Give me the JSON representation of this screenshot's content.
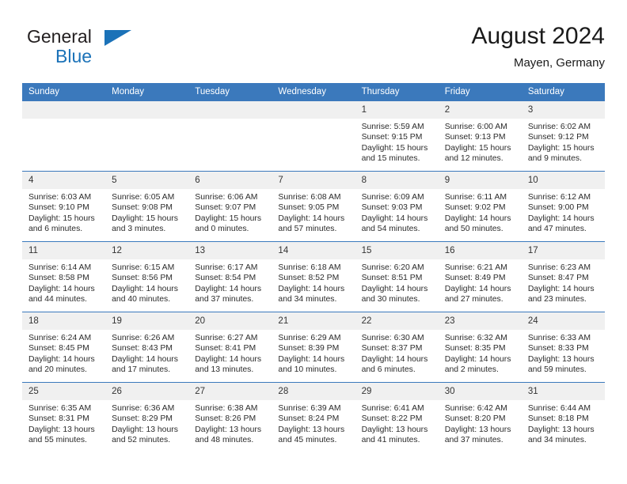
{
  "brand": {
    "name_part1": "General",
    "name_part2": "Blue",
    "accent_color": "#1b72b8",
    "logo_icon": "triangle-mark"
  },
  "header": {
    "title": "August 2024",
    "subtitle": "Mayen, Germany"
  },
  "theme": {
    "header_blue": "#3b79bc",
    "daynum_band": "#f0f0f0",
    "text": "#2b2b2b"
  },
  "weekdays": [
    "Sunday",
    "Monday",
    "Tuesday",
    "Wednesday",
    "Thursday",
    "Friday",
    "Saturday"
  ],
  "labels": {
    "sunrise_prefix": "Sunrise:",
    "sunset_prefix": "Sunset:",
    "daylight_prefix": "Daylight:"
  },
  "weeks": [
    [
      {
        "day": "",
        "blank": true,
        "l1": "",
        "l2": "",
        "l3": "",
        "l4": ""
      },
      {
        "day": "",
        "blank": true,
        "l1": "",
        "l2": "",
        "l3": "",
        "l4": ""
      },
      {
        "day": "",
        "blank": true,
        "l1": "",
        "l2": "",
        "l3": "",
        "l4": ""
      },
      {
        "day": "",
        "blank": true,
        "l1": "",
        "l2": "",
        "l3": "",
        "l4": ""
      },
      {
        "day": "1",
        "blank": false,
        "l1": "Sunrise: 5:59 AM",
        "l2": "Sunset: 9:15 PM",
        "l3": "Daylight: 15 hours",
        "l4": "and 15 minutes."
      },
      {
        "day": "2",
        "blank": false,
        "l1": "Sunrise: 6:00 AM",
        "l2": "Sunset: 9:13 PM",
        "l3": "Daylight: 15 hours",
        "l4": "and 12 minutes."
      },
      {
        "day": "3",
        "blank": false,
        "l1": "Sunrise: 6:02 AM",
        "l2": "Sunset: 9:12 PM",
        "l3": "Daylight: 15 hours",
        "l4": "and 9 minutes."
      }
    ],
    [
      {
        "day": "4",
        "blank": false,
        "l1": "Sunrise: 6:03 AM",
        "l2": "Sunset: 9:10 PM",
        "l3": "Daylight: 15 hours",
        "l4": "and 6 minutes."
      },
      {
        "day": "5",
        "blank": false,
        "l1": "Sunrise: 6:05 AM",
        "l2": "Sunset: 9:08 PM",
        "l3": "Daylight: 15 hours",
        "l4": "and 3 minutes."
      },
      {
        "day": "6",
        "blank": false,
        "l1": "Sunrise: 6:06 AM",
        "l2": "Sunset: 9:07 PM",
        "l3": "Daylight: 15 hours",
        "l4": "and 0 minutes."
      },
      {
        "day": "7",
        "blank": false,
        "l1": "Sunrise: 6:08 AM",
        "l2": "Sunset: 9:05 PM",
        "l3": "Daylight: 14 hours",
        "l4": "and 57 minutes."
      },
      {
        "day": "8",
        "blank": false,
        "l1": "Sunrise: 6:09 AM",
        "l2": "Sunset: 9:03 PM",
        "l3": "Daylight: 14 hours",
        "l4": "and 54 minutes."
      },
      {
        "day": "9",
        "blank": false,
        "l1": "Sunrise: 6:11 AM",
        "l2": "Sunset: 9:02 PM",
        "l3": "Daylight: 14 hours",
        "l4": "and 50 minutes."
      },
      {
        "day": "10",
        "blank": false,
        "l1": "Sunrise: 6:12 AM",
        "l2": "Sunset: 9:00 PM",
        "l3": "Daylight: 14 hours",
        "l4": "and 47 minutes."
      }
    ],
    [
      {
        "day": "11",
        "blank": false,
        "l1": "Sunrise: 6:14 AM",
        "l2": "Sunset: 8:58 PM",
        "l3": "Daylight: 14 hours",
        "l4": "and 44 minutes."
      },
      {
        "day": "12",
        "blank": false,
        "l1": "Sunrise: 6:15 AM",
        "l2": "Sunset: 8:56 PM",
        "l3": "Daylight: 14 hours",
        "l4": "and 40 minutes."
      },
      {
        "day": "13",
        "blank": false,
        "l1": "Sunrise: 6:17 AM",
        "l2": "Sunset: 8:54 PM",
        "l3": "Daylight: 14 hours",
        "l4": "and 37 minutes."
      },
      {
        "day": "14",
        "blank": false,
        "l1": "Sunrise: 6:18 AM",
        "l2": "Sunset: 8:52 PM",
        "l3": "Daylight: 14 hours",
        "l4": "and 34 minutes."
      },
      {
        "day": "15",
        "blank": false,
        "l1": "Sunrise: 6:20 AM",
        "l2": "Sunset: 8:51 PM",
        "l3": "Daylight: 14 hours",
        "l4": "and 30 minutes."
      },
      {
        "day": "16",
        "blank": false,
        "l1": "Sunrise: 6:21 AM",
        "l2": "Sunset: 8:49 PM",
        "l3": "Daylight: 14 hours",
        "l4": "and 27 minutes."
      },
      {
        "day": "17",
        "blank": false,
        "l1": "Sunrise: 6:23 AM",
        "l2": "Sunset: 8:47 PM",
        "l3": "Daylight: 14 hours",
        "l4": "and 23 minutes."
      }
    ],
    [
      {
        "day": "18",
        "blank": false,
        "l1": "Sunrise: 6:24 AM",
        "l2": "Sunset: 8:45 PM",
        "l3": "Daylight: 14 hours",
        "l4": "and 20 minutes."
      },
      {
        "day": "19",
        "blank": false,
        "l1": "Sunrise: 6:26 AM",
        "l2": "Sunset: 8:43 PM",
        "l3": "Daylight: 14 hours",
        "l4": "and 17 minutes."
      },
      {
        "day": "20",
        "blank": false,
        "l1": "Sunrise: 6:27 AM",
        "l2": "Sunset: 8:41 PM",
        "l3": "Daylight: 14 hours",
        "l4": "and 13 minutes."
      },
      {
        "day": "21",
        "blank": false,
        "l1": "Sunrise: 6:29 AM",
        "l2": "Sunset: 8:39 PM",
        "l3": "Daylight: 14 hours",
        "l4": "and 10 minutes."
      },
      {
        "day": "22",
        "blank": false,
        "l1": "Sunrise: 6:30 AM",
        "l2": "Sunset: 8:37 PM",
        "l3": "Daylight: 14 hours",
        "l4": "and 6 minutes."
      },
      {
        "day": "23",
        "blank": false,
        "l1": "Sunrise: 6:32 AM",
        "l2": "Sunset: 8:35 PM",
        "l3": "Daylight: 14 hours",
        "l4": "and 2 minutes."
      },
      {
        "day": "24",
        "blank": false,
        "l1": "Sunrise: 6:33 AM",
        "l2": "Sunset: 8:33 PM",
        "l3": "Daylight: 13 hours",
        "l4": "and 59 minutes."
      }
    ],
    [
      {
        "day": "25",
        "blank": false,
        "l1": "Sunrise: 6:35 AM",
        "l2": "Sunset: 8:31 PM",
        "l3": "Daylight: 13 hours",
        "l4": "and 55 minutes."
      },
      {
        "day": "26",
        "blank": false,
        "l1": "Sunrise: 6:36 AM",
        "l2": "Sunset: 8:29 PM",
        "l3": "Daylight: 13 hours",
        "l4": "and 52 minutes."
      },
      {
        "day": "27",
        "blank": false,
        "l1": "Sunrise: 6:38 AM",
        "l2": "Sunset: 8:26 PM",
        "l3": "Daylight: 13 hours",
        "l4": "and 48 minutes."
      },
      {
        "day": "28",
        "blank": false,
        "l1": "Sunrise: 6:39 AM",
        "l2": "Sunset: 8:24 PM",
        "l3": "Daylight: 13 hours",
        "l4": "and 45 minutes."
      },
      {
        "day": "29",
        "blank": false,
        "l1": "Sunrise: 6:41 AM",
        "l2": "Sunset: 8:22 PM",
        "l3": "Daylight: 13 hours",
        "l4": "and 41 minutes."
      },
      {
        "day": "30",
        "blank": false,
        "l1": "Sunrise: 6:42 AM",
        "l2": "Sunset: 8:20 PM",
        "l3": "Daylight: 13 hours",
        "l4": "and 37 minutes."
      },
      {
        "day": "31",
        "blank": false,
        "l1": "Sunrise: 6:44 AM",
        "l2": "Sunset: 8:18 PM",
        "l3": "Daylight: 13 hours",
        "l4": "and 34 minutes."
      }
    ]
  ]
}
